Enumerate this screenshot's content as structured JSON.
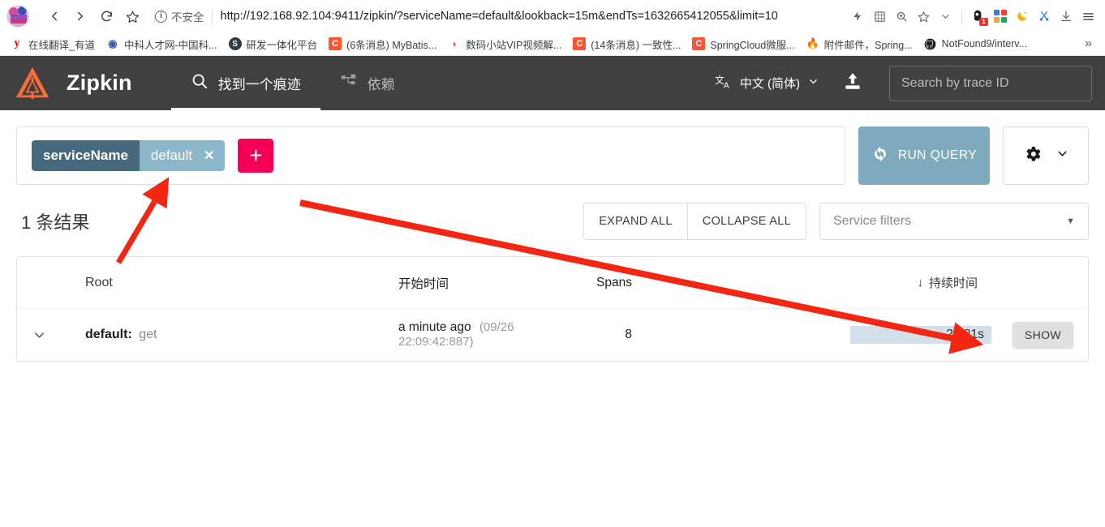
{
  "browser": {
    "nav": {
      "back": "back-arrow",
      "forward": "forward-arrow",
      "reload": "reload",
      "bookmark": "star"
    },
    "security_label": "不安全",
    "url": "http://192.168.92.104:9411/zipkin/?serviceName=default&lookback=15m&endTs=1632665412055&limit=10",
    "bookmarks": [
      {
        "label": "在线翻译_有道",
        "icon": "youdao-icon",
        "icon_text": "y",
        "icon_bg": "#ffffff",
        "icon_fg": "#d40000"
      },
      {
        "label": "中科人才网-中国科...",
        "icon": "site-icon",
        "icon_text": "◉",
        "icon_bg": "#ffffff",
        "icon_fg": "#3a56a8"
      },
      {
        "label": "研发一体化平台",
        "icon": "globe-icon",
        "icon_text": "S",
        "icon_bg": "#2f3b45",
        "icon_fg": "#ffffff"
      },
      {
        "label": "(6条消息) MyBatis...",
        "icon": "csdn-icon",
        "icon_text": "C",
        "icon_bg": "#fc5531",
        "icon_fg": "#ffffff"
      },
      {
        "label": "数码小站VIP视频解...",
        "icon": "video-icon",
        "icon_text": "▶",
        "icon_bg": "#ffffff",
        "icon_fg": "#e6407a"
      },
      {
        "label": "(14条消息) 一致性...",
        "icon": "csdn-icon",
        "icon_text": "C",
        "icon_bg": "#fc5531",
        "icon_fg": "#ffffff"
      },
      {
        "label": "SpringCloud微服...",
        "icon": "csdn-icon",
        "icon_text": "C",
        "icon_bg": "#fc5531",
        "icon_fg": "#ffffff"
      },
      {
        "label": "附件邮件，Spring...",
        "icon": "flame-icon",
        "icon_text": "🔥",
        "icon_bg": "#ffffff",
        "icon_fg": "#e8534f"
      },
      {
        "label": "NotFound9/interv...",
        "icon": "github-icon",
        "icon_text": "",
        "icon_bg": "#ffffff",
        "icon_fg": "#1b1f23"
      }
    ],
    "bookmarks_overflow": "»",
    "toolbar_icons": [
      {
        "name": "lightning-icon"
      },
      {
        "name": "screenshot-icon"
      },
      {
        "name": "zoom-icon"
      },
      {
        "name": "star-icon"
      },
      {
        "name": "chevron-down-icon"
      },
      {
        "name": "extension-icon",
        "badge": "1"
      },
      {
        "name": "apps-grid-icon"
      },
      {
        "name": "dark-mode-icon"
      },
      {
        "name": "scissors-icon"
      },
      {
        "name": "download-icon"
      },
      {
        "name": "menu-icon"
      }
    ]
  },
  "zipkin": {
    "brand": "Zipkin",
    "nav": [
      {
        "label": "找到一个痕迹",
        "icon": "search-icon",
        "active": true
      },
      {
        "label": "依赖",
        "icon": "dependency-tree-icon",
        "active": false
      }
    ],
    "language": "中文 (简体)",
    "upload_icon": "upload-icon",
    "trace_search_placeholder": "Search by trace ID",
    "query": {
      "chip_key": "serviceName",
      "chip_value": "default",
      "chip_remove": "✕",
      "add_label": "+",
      "run_query_label": "RUN QUERY",
      "settings_icon": "gear-icon"
    },
    "results": {
      "count_label": "1 条结果",
      "expand_all": "EXPAND ALL",
      "collapse_all": "COLLAPSE ALL",
      "service_filters_placeholder": "Service filters",
      "columns": {
        "root": "Root",
        "start_time": "开始时间",
        "spans": "Spans",
        "duration": "持续时间",
        "duration_sort_icon": "↓"
      },
      "rows": [
        {
          "expand_icon": "chevron-down-icon",
          "service": "default:",
          "operation": "get",
          "start_relative": "a minute ago",
          "start_absolute": "(09/26 22:09:42:887)",
          "spans": "8",
          "duration": "2.781s",
          "duration_bar_pct": 100,
          "show_label": "SHOW"
        }
      ]
    }
  },
  "colors": {
    "header_bg": "#404040",
    "accent_pink": "#f50057",
    "chip_key": "#46697d",
    "chip_value": "#8cb6c9",
    "run_query": "#7fa9bd",
    "duration_bar": "#d3e0e9",
    "annotation_arrow": "#f22613"
  }
}
